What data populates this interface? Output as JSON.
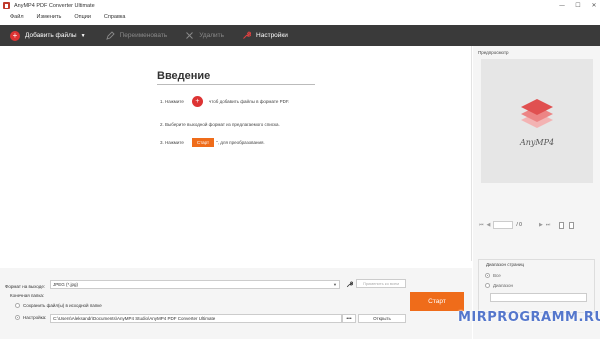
{
  "window": {
    "title": "AnyMP4 PDF Converter Ultimate",
    "controls": [
      "—",
      "☐",
      "✕"
    ]
  },
  "menu": [
    "Файл",
    "Изменить",
    "Опции",
    "Справка"
  ],
  "toolbar": {
    "add_files": "Добавить файлы",
    "rename": "Переименовать",
    "delete": "Удалить",
    "settings": "Настройки"
  },
  "intro": {
    "title": "Введение",
    "step1_before": "1. Нажмите",
    "step1_after": "чтоб добавить файлы в формате PDF.",
    "step2": "2. Выберите выходной формат из предлагаемого списка.",
    "step3_before": "3. Нажмите",
    "step3_button": "Старт",
    "step3_after": "\", для преобразования."
  },
  "preview": {
    "label": "Предпросмотр",
    "logo_text": "AnyMP4",
    "page_total": "/ 0"
  },
  "page_range": {
    "title": "Диапазон страниц",
    "all": "Все",
    "range": "Диапазон"
  },
  "output": {
    "format_label": "Формат на выходе:",
    "format_value": "JPEG (*.jpg)",
    "apply_all": "Применить ко всем",
    "dest_label": "Конечная папка:",
    "save_source": "Сохранить файл(ы) в исходной папке",
    "custom_label": "Настройка:",
    "custom_path": "C:\\Users\\Aleksandr\\Documents\\AnyMP4 Studio\\AnyMP4 PDF Converter Ultimate",
    "more": "•••",
    "open": "Открыть",
    "start": "Старт"
  },
  "watermark": "MIRPROGRAMM.RU",
  "colors": {
    "toolbar_bg": "#3a3a3a",
    "accent_orange": "#ef6c1a",
    "accent_red": "#dd3333"
  }
}
